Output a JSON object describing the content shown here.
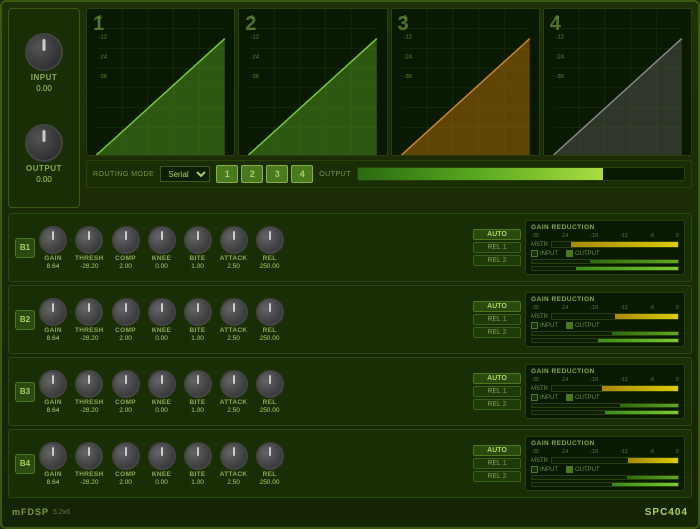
{
  "app": {
    "title": "SPC404",
    "brand": "mFDSP",
    "version": "5.2x6"
  },
  "io": {
    "input_label": "INPUT",
    "input_value": "0.00",
    "output_label": "OUTPUT",
    "output_value": "0.00"
  },
  "routing": {
    "label": "ROUTING MODE",
    "mode": "Serial",
    "output_label": "OUTPUT"
  },
  "band_buttons": [
    "1",
    "2",
    "3",
    "4"
  ],
  "displays": [
    {
      "number": "1",
      "color": "#7acc30"
    },
    {
      "number": "2",
      "color": "#7acc30"
    },
    {
      "number": "3",
      "color": "#cc8820"
    },
    {
      "number": "4",
      "color": "#888888"
    }
  ],
  "bands": [
    {
      "id": "B1",
      "controls": [
        {
          "label": "GAIN",
          "value": "8.64"
        },
        {
          "label": "THRESH",
          "value": "-28.20"
        },
        {
          "label": "COMP",
          "value": "2.00"
        },
        {
          "label": "KNEE",
          "value": "0.00"
        },
        {
          "label": "BITE",
          "value": "1.00"
        },
        {
          "label": "ATTACK",
          "value": "2.50"
        },
        {
          "label": "REL",
          "value": "250.00"
        }
      ],
      "buttons": {
        "auto": "AUTO",
        "rel1": "REL 1",
        "rel2": "REL 2"
      },
      "gr": {
        "title": "GAIN REDUCTION",
        "mstr": "MSTR"
      }
    },
    {
      "id": "B2",
      "controls": [
        {
          "label": "GAIN",
          "value": "8.64"
        },
        {
          "label": "THRESH",
          "value": "-28.20"
        },
        {
          "label": "COMP",
          "value": "2.00"
        },
        {
          "label": "KNEE",
          "value": "0.00"
        },
        {
          "label": "BITE",
          "value": "1.00"
        },
        {
          "label": "ATTACK",
          "value": "2.50"
        },
        {
          "label": "REL",
          "value": "250.00"
        }
      ],
      "buttons": {
        "auto": "AUTO",
        "rel1": "REL 1",
        "rel2": "REL 2"
      },
      "gr": {
        "title": "GAIN REDUCTION",
        "mstr": "MSTR"
      }
    },
    {
      "id": "B3",
      "controls": [
        {
          "label": "GAIN",
          "value": "8.64"
        },
        {
          "label": "THRESH",
          "value": "-28.20"
        },
        {
          "label": "COMP",
          "value": "2.00"
        },
        {
          "label": "KNEE",
          "value": "0.00"
        },
        {
          "label": "BITE",
          "value": "1.00"
        },
        {
          "label": "ATTACK",
          "value": "2.50"
        },
        {
          "label": "REL",
          "value": "250.00"
        }
      ],
      "buttons": {
        "auto": "AUTO",
        "rel1": "REL 1",
        "rel2": "REL 2"
      },
      "gr": {
        "title": "GAIN REDUCTION",
        "mstr": "MSTR"
      }
    },
    {
      "id": "B4",
      "controls": [
        {
          "label": "GAIN",
          "value": "8.64"
        },
        {
          "label": "THRESH",
          "value": "-28.20"
        },
        {
          "label": "COMP",
          "value": "2.00"
        },
        {
          "label": "KNEE",
          "value": "0.00"
        },
        {
          "label": "BITE",
          "value": "1.00"
        },
        {
          "label": "ATTACK",
          "value": "2.50"
        },
        {
          "label": "REL",
          "value": "250.00"
        }
      ],
      "buttons": {
        "auto": "AUTO",
        "rel1": "REL 1",
        "rel2": "REL 2"
      },
      "gr": {
        "title": "GAIN REDUCTION",
        "mstr": "MSTR"
      }
    }
  ],
  "gr_scale": [
    "-30",
    "-24",
    "-18",
    "-12",
    "-6",
    "0"
  ],
  "colors": {
    "bg": "#1a2a0a",
    "panel": "#1a2e06",
    "border": "#3a5a10",
    "accent": "#aad060",
    "dim": "#5a7a30"
  }
}
